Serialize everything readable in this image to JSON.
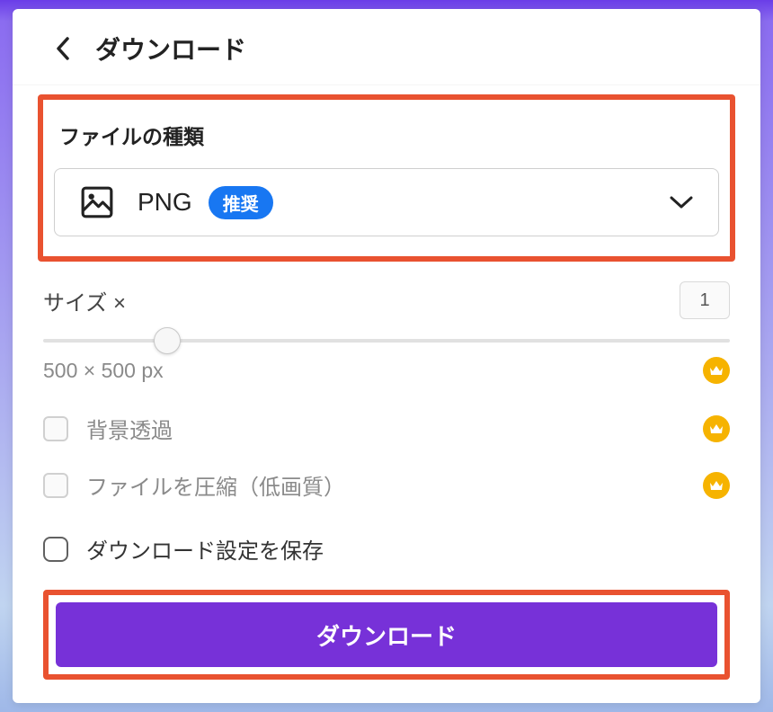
{
  "header": {
    "title": "ダウンロード"
  },
  "file_type": {
    "label": "ファイルの種類",
    "selected": "PNG",
    "badge": "推奨"
  },
  "size": {
    "label": "サイズ ×",
    "value": "1",
    "dimensions": "500 × 500 px"
  },
  "options": {
    "transparent_bg": "背景透過",
    "compress": "ファイルを圧縮（低画質）",
    "save_settings": "ダウンロード設定を保存"
  },
  "download_button": "ダウンロード"
}
